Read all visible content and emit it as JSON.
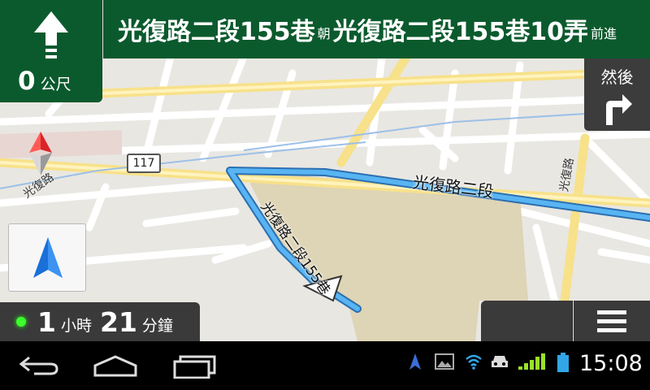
{
  "instruction": {
    "distance_value": "0",
    "distance_unit": "公尺",
    "maneuver_icon": "straight-arrow-icon",
    "street_from": "光復路二段155巷",
    "connector": "朝",
    "street_to": "光復路二段155巷10弄",
    "suffix": "前進"
  },
  "next_turn": {
    "label": "然後",
    "icon": "turn-right-icon"
  },
  "map": {
    "road_label_main": "光復路二段",
    "road_label_side": "光復路二段155巷",
    "route_shield": "117",
    "road_label_left": "光復路",
    "road_label_right": "光復路",
    "route_color": "#3f9ce4"
  },
  "eta": {
    "hours_value": "1",
    "hours_unit": "小時",
    "minutes_value": "21",
    "minutes_unit": "分鐘"
  },
  "status_bar": {
    "time": "15:08"
  },
  "colors": {
    "header_green": "#0b5a2d",
    "panel_dark": "#3a3a3a",
    "accent_green": "#3dff2d"
  }
}
